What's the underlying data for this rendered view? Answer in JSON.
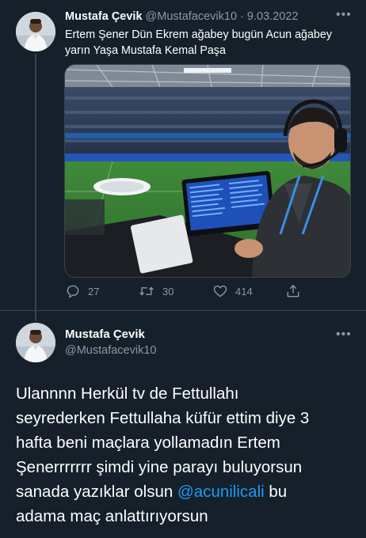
{
  "tweet1": {
    "author_name": "Mustafa Çevik",
    "handle": "@Mustafacevik10",
    "separator": "·",
    "date": "9.03.2022",
    "more_label": "•••",
    "text": "Ertem Şener Dün Ekrem ağabey bugün Acun ağabey yarın Yaşa Mustafa Kemal Paşa",
    "media_icon": "photo-commentator-stadium",
    "actions": {
      "replies": "27",
      "retweets": "30",
      "likes": "414"
    }
  },
  "tweet2": {
    "author_name": "Mustafa Çevik",
    "handle": "@Mustafacevik10",
    "more_label": "•••",
    "text_lines": [
      "Ulannnn Herkül tv de Fettullahı",
      "seyrederken Fettullaha küfür ettim diye 3",
      "hafta beni maçlara yollamadın Ertem",
      "Şenerrrrrrr şimdi yine parayı buluyorsun",
      "sanada yazıklar olsun ",
      "adama maç anlattırıyorsun"
    ],
    "mention": "@acunilicali",
    "after_mention": " bu"
  },
  "colors": {
    "background": "#15202b",
    "text": "#ffffff",
    "muted": "#8899a6",
    "link": "#1d9bf0",
    "divider": "#38444d"
  }
}
